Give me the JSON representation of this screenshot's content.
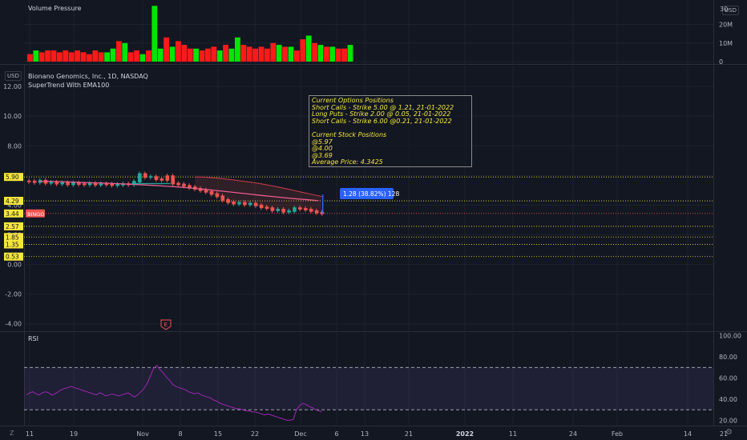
{
  "header": {
    "volume_title": "Volume Pressure",
    "symbol": "Bionano Genomics, Inc., 1D, NASDAQ",
    "indicator": "SuperTrend With EMA100",
    "rsi_title": "RSI",
    "currency": "USD",
    "currency_top": "USD",
    "top_axis_partial": "30",
    "zoom_z": "Z",
    "gear": "⚙",
    "settings_bottom": "⚙"
  },
  "note": {
    "lines": [
      "Current Options Positions",
      "Short Calls - Strike 5.00 @ 1.21, 21-01-2022",
      "Long Puts - Strike 2.00 @ 0.05, 21-01-2022",
      "Short Calls - Strike 6.00 @0.21, 21-01-2022",
      "",
      "Current Stock Positions",
      "@5.97",
      "@4.00",
      "@3.69",
      "Average Price: 4.3425"
    ]
  },
  "measure_label": "1.28 (38.82%) 128",
  "bingo_label": "BINGO",
  "earnings_marker": "E",
  "colors": {
    "bg": "#131722",
    "up": "#26a69a",
    "down": "#ef5350",
    "vol_up": "#00e600",
    "vol_down": "#ff1a1a",
    "rsi_line": "#9c27b0",
    "level_yellow": "#f5e63a",
    "measure_blue": "#2962ff"
  },
  "chart_data": [
    {
      "type": "bar",
      "title": "Volume Pressure",
      "y_ticks": [
        "30M",
        "20M",
        "10M",
        "0"
      ],
      "ylim": [
        0,
        30000000
      ],
      "values_m": [
        4,
        6,
        5,
        6,
        6,
        5,
        6,
        5,
        6,
        5,
        4,
        6,
        5,
        5,
        7,
        11,
        10,
        5,
        6,
        4,
        6,
        30,
        7,
        13,
        8,
        11,
        9,
        7,
        7,
        6,
        7,
        8,
        6,
        9,
        7,
        13,
        9,
        8,
        7,
        8,
        7,
        10,
        9,
        8,
        8,
        6,
        12,
        14,
        10,
        9,
        8,
        8,
        7,
        7,
        9
      ],
      "up": [
        false,
        true,
        false,
        false,
        false,
        false,
        false,
        false,
        false,
        false,
        false,
        false,
        false,
        true,
        true,
        false,
        true,
        false,
        false,
        true,
        false,
        true,
        true,
        false,
        true,
        false,
        false,
        false,
        true,
        false,
        false,
        false,
        true,
        false,
        true,
        true,
        false,
        false,
        false,
        false,
        false,
        false,
        true,
        false,
        true,
        false,
        false,
        true,
        false,
        true,
        false,
        true,
        false,
        false,
        true
      ]
    },
    {
      "type": "candlestick",
      "title": "Bionano Genomics, Inc., 1D, NASDAQ",
      "y_ticks": [
        "12.00",
        "10.00",
        "8.00",
        "6.00",
        "4.00",
        "2.00",
        "0.00",
        "-2.00",
        "-4.00"
      ],
      "ylim": [
        -4.5,
        13.3
      ],
      "x_ticks": [
        "11",
        "19",
        "Nov",
        "8",
        "15",
        "22",
        "Dec",
        "6",
        "13",
        "21",
        "2022",
        "11",
        "24",
        "Feb",
        "14",
        "21"
      ],
      "close": [
        5.6,
        5.55,
        5.65,
        5.5,
        5.52,
        5.45,
        5.5,
        5.4,
        5.48,
        5.42,
        5.4,
        5.45,
        5.38,
        5.42,
        5.4,
        5.35,
        5.38,
        5.42,
        5.4,
        5.58,
        6.1,
        5.9,
        5.9,
        5.75,
        5.7,
        5.95,
        5.45,
        5.4,
        5.3,
        5.2,
        5.1,
        5.0,
        4.9,
        4.75,
        4.6,
        4.35,
        4.2,
        4.1,
        4.15,
        4.05,
        4.1,
        3.98,
        3.85,
        3.8,
        3.65,
        3.7,
        3.55,
        3.6,
        3.8,
        3.75,
        3.7,
        3.6,
        3.5,
        3.44
      ],
      "up": [
        false,
        false,
        true,
        false,
        true,
        false,
        true,
        false,
        true,
        false,
        false,
        true,
        false,
        true,
        false,
        false,
        true,
        true,
        false,
        true,
        true,
        false,
        true,
        false,
        false,
        false,
        false,
        false,
        false,
        false,
        false,
        false,
        false,
        false,
        false,
        false,
        false,
        false,
        true,
        false,
        true,
        false,
        false,
        false,
        false,
        true,
        false,
        true,
        true,
        false,
        false,
        false,
        false,
        false
      ],
      "ema100": [
        5.6,
        5.6,
        5.58,
        5.55,
        5.52,
        5.5,
        5.47,
        5.44,
        5.4,
        5.36,
        5.32,
        5.27,
        5.22,
        5.15,
        5.08,
        5.0,
        4.92,
        4.83,
        4.75,
        4.66,
        4.58,
        4.5,
        4.43,
        4.37,
        4.3
      ],
      "supertrend": [
        5.9,
        5.9,
        5.88,
        5.85,
        5.82,
        5.78,
        5.74,
        5.7,
        5.65,
        5.6,
        5.55,
        5.5,
        5.44,
        5.37,
        5.3,
        5.23,
        5.15,
        5.07,
        4.99,
        4.9,
        4.82,
        4.74,
        4.66,
        4.58
      ],
      "level_labels": [
        "5.90",
        "4.29",
        "3.44",
        "2.57",
        "1.85",
        "1.35",
        "0.53"
      ],
      "levels": [
        5.9,
        4.29,
        3.44,
        2.57,
        1.85,
        1.35,
        0.53
      ],
      "measure": {
        "from": 3.44,
        "to": 4.72
      }
    },
    {
      "type": "line",
      "title": "RSI",
      "y_ticks": [
        "100.00",
        "80.00",
        "60.00",
        "40.00",
        "20.00"
      ],
      "ylim": [
        15,
        102
      ],
      "bands": [
        70,
        30
      ],
      "values": [
        44,
        46,
        47,
        45,
        44,
        46,
        47,
        46,
        44,
        45,
        47,
        49,
        50,
        51,
        52,
        51,
        50,
        49,
        48,
        47,
        46,
        45,
        44,
        46,
        45,
        43,
        44,
        45,
        44,
        43,
        44,
        45,
        46,
        44,
        42,
        44,
        47,
        50,
        55,
        62,
        69,
        72,
        68,
        65,
        61,
        58,
        54,
        52,
        51,
        50,
        49,
        47,
        46,
        45,
        46,
        44,
        43,
        42,
        41,
        39,
        38,
        36,
        35,
        34,
        33,
        32,
        31,
        31,
        30,
        29,
        29,
        28,
        28,
        27,
        26,
        25,
        26,
        25,
        24,
        23,
        22,
        21,
        20,
        20,
        21,
        30,
        34,
        36,
        35,
        33,
        32,
        30,
        29,
        28
      ]
    }
  ]
}
